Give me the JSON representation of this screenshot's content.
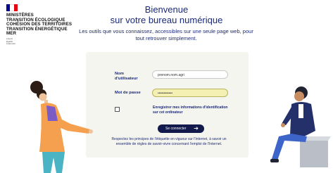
{
  "brand": {
    "lines": [
      "MINISTÈRES",
      "TRANSITION ÉCOLOGIQUE",
      "COHÉSION DES TERRITOIRES",
      "TRANSITION ÉNERGÉTIQUE",
      "MER"
    ],
    "motto": [
      "Liberté",
      "Égalité",
      "Fraternité"
    ],
    "flag_colors": [
      "#000091",
      "#ffffff",
      "#e1000f"
    ]
  },
  "header": {
    "title_line1": "Bienvenue",
    "title_line2": "sur votre bureau numérique",
    "subtitle": "Les outils que vous connaissez, accessibles sur une seule page web, pour tout retrouver simplement."
  },
  "login": {
    "username_label": "Nom d'utilisateur",
    "username_value": "prenom.nom.agri",
    "password_label": "Mot de passe",
    "password_value": "••••••••••••",
    "remember_label": "Enregistrer mes informations d'identification sur cet ordinateur",
    "submit_label": "Se connecter",
    "footer_note": "Respectez les principes de l'étiquette en vigueur sur l'Internet, à savoir un ensemble de règles de savoir-vivre concernant l'emploi de l'Internet."
  },
  "colors": {
    "accent": "#1b2a7a",
    "button": "#121a4b",
    "password_bg": "#f4f0b4",
    "panel_bg": "#f5f5ef"
  },
  "icons": {
    "submit": "arrow-right-icon"
  }
}
